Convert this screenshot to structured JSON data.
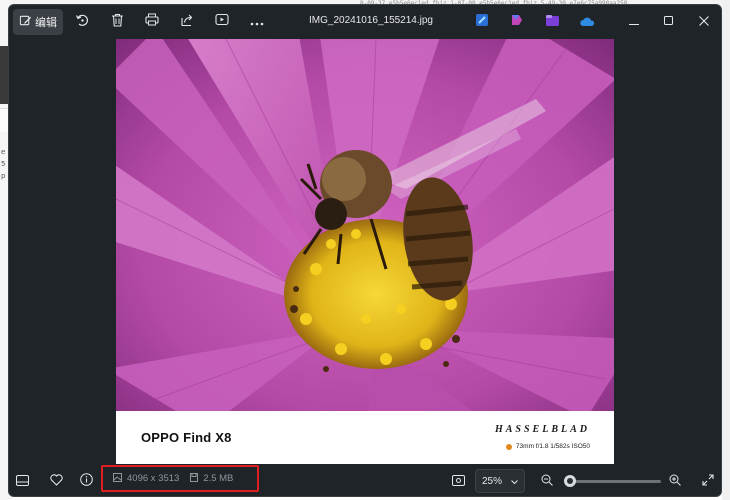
{
  "background_app": {
    "top_strip_text": "8-09-37_e5b5e6ec1ed.fbiz     1-07-08_e5b5e6ec1ed.fbiz     5-49-30_e7e6c75a998aa258",
    "left_fragments": [
      "e",
      "5",
      "p"
    ]
  },
  "titlebar": {
    "edit_label": "编辑",
    "file_name": "IMG_20241016_155214.jpg",
    "icons": [
      "edit-icon",
      "rotate-icon",
      "delete-icon",
      "print-icon",
      "share-icon",
      "slideshow-icon",
      "more-icon",
      "clipchamp-icon",
      "designer-icon",
      "clipchamp-folder-icon",
      "onedrive-icon"
    ],
    "window_controls": [
      "minimize",
      "maximize",
      "close"
    ]
  },
  "photo": {
    "watermark_model": "OPPO Find X8",
    "watermark_brand": "HASSELBLAD",
    "watermark_specs": "73mm f/1.8 1/582s ISO50",
    "colors": {
      "petal": "#c85ab8",
      "petal_dark": "#8d2f86",
      "center": "#e8c020",
      "dot": "#e08a1e"
    }
  },
  "bottombar": {
    "dimensions": "4096 x 3513",
    "file_size": "2.5 MB",
    "zoom": "25%",
    "zoom_fraction": 0.05,
    "highlight_color": "#e02020"
  }
}
